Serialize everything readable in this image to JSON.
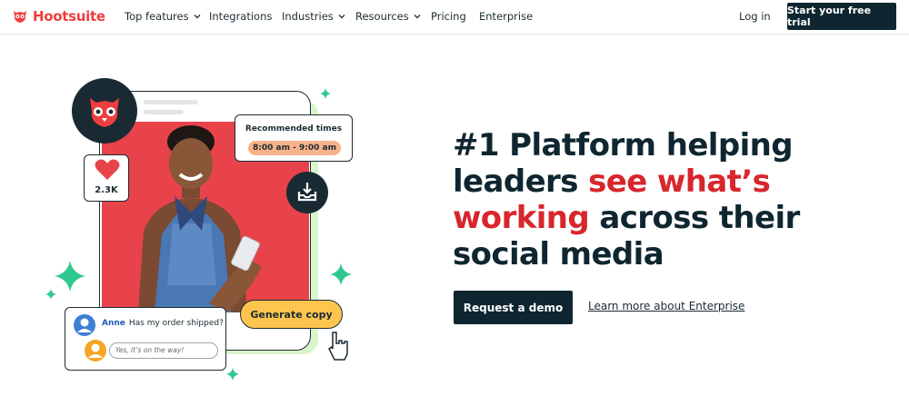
{
  "nav": {
    "brand": "Hootsuite",
    "items": [
      {
        "label": "Top features",
        "has_dropdown": true
      },
      {
        "label": "Integrations",
        "has_dropdown": false
      },
      {
        "label": "Industries",
        "has_dropdown": true
      },
      {
        "label": "Resources",
        "has_dropdown": true
      },
      {
        "label": "Pricing",
        "has_dropdown": false
      },
      {
        "label": "Enterprise",
        "has_dropdown": false
      }
    ],
    "login": "Log in",
    "cta": "Start your free trial"
  },
  "hero": {
    "headline_part1": "#1 Platform helping leaders",
    "headline_accent": "see what’s working",
    "headline_part2": "across their social media",
    "primary_button": "Request a demo",
    "secondary_link": "Learn more about Enterprise"
  },
  "illustration": {
    "recommended_title": "Recommended times",
    "recommended_time": "8:00 am - 9:00 am",
    "likes": "2.3K",
    "message_author": "Anne",
    "message_text": "Has my order shipped?",
    "reply_text": "Yes, it’s on the way!",
    "generate_button": "Generate copy"
  },
  "colors": {
    "brand_red": "#ee3e3e",
    "accent_red": "#d8262d",
    "dark_navy": "#0f2630",
    "photo_red": "#e8434a",
    "pill_peach": "#f8b38a",
    "button_yellow": "#fdc54e",
    "sparkle_green": "#2fc98e"
  },
  "icons": [
    "owl-logo-icon",
    "chevron-down-icon",
    "heart-icon",
    "inbox-icon",
    "sparkle-icon",
    "pointer-hand-icon",
    "avatar-icon"
  ]
}
